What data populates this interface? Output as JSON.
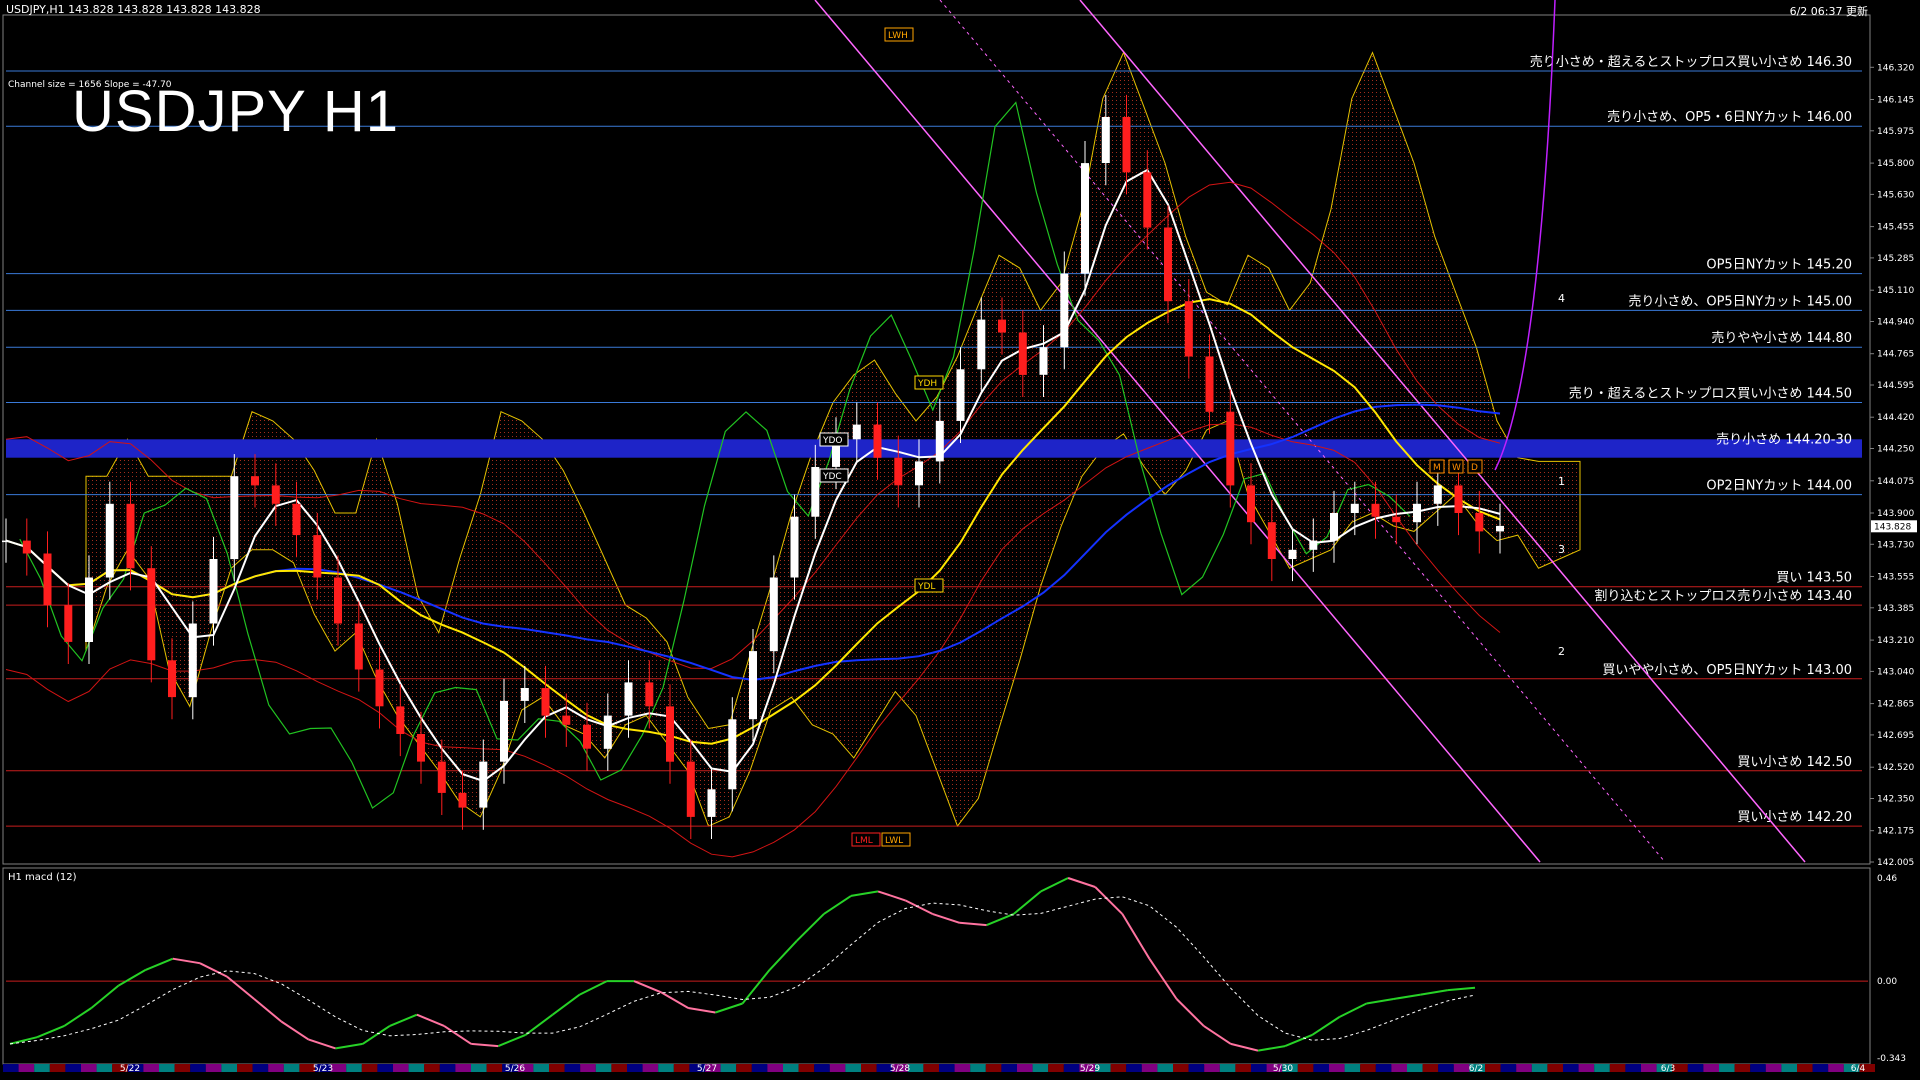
{
  "header": {
    "symbol_info": "USDJPY,H1  143.828 143.828 143.828 143.828",
    "updated": "6/2 06:37 更新",
    "channel_info": "Channel size = 1656 Slope = -47.70",
    "title": "USDJPY H1"
  },
  "colors": {
    "background": "#000000",
    "bull_candle": "#ffffff",
    "bear_candle": "#ff1e1e",
    "sma_white": "#ffffff",
    "sma_yellow": "#ffe600",
    "sma_blue": "#1432ff",
    "bollinger": "#d21414",
    "chikou": "#21c321",
    "channel": "#ff66ff",
    "cloud_bear": "#b4321e",
    "cloud_bull": "#b4b4b4",
    "resistance_line": "#3a7ad8",
    "support_line": "#c81e1e",
    "macd_up": "#27d227",
    "macd_down": "#ff73a0",
    "zone": "#1e24c8"
  },
  "chart_data": {
    "type": "line",
    "title": "USDJPY H1",
    "ylim": [
      142.005,
      146.49
    ],
    "price_ticks": [
      "146.320",
      "146.145",
      "145.975",
      "145.800",
      "145.630",
      "145.455",
      "145.285",
      "145.110",
      "144.940",
      "144.765",
      "144.595",
      "144.420",
      "144.250",
      "144.075",
      "143.900",
      "143.730",
      "143.555",
      "143.385",
      "143.210",
      "143.040",
      "142.865",
      "142.695",
      "142.520",
      "142.350",
      "142.175",
      "142.005"
    ],
    "last_price": "143.828",
    "date_labels": [
      "5/22",
      "5/23",
      "5/26",
      "5/27",
      "5/28",
      "5/29",
      "5/30",
      "6/2",
      "6/3",
      "6/4"
    ],
    "close_series": [
      143.75,
      143.68,
      143.4,
      143.2,
      143.55,
      143.95,
      143.6,
      143.1,
      142.9,
      143.3,
      143.65,
      144.1,
      144.05,
      143.95,
      143.78,
      143.55,
      143.3,
      143.05,
      142.85,
      142.7,
      142.55,
      142.38,
      142.3,
      142.55,
      142.88,
      142.95,
      142.8,
      142.75,
      142.62,
      142.8,
      142.98,
      142.85,
      142.55,
      142.25,
      142.4,
      142.78,
      143.15,
      143.55,
      143.88,
      144.15,
      144.3,
      144.38,
      144.2,
      144.05,
      144.18,
      144.4,
      144.68,
      144.95,
      144.88,
      144.65,
      144.8,
      145.2,
      145.8,
      146.05,
      145.75,
      145.45,
      145.05,
      144.75,
      144.45,
      144.05,
      143.85,
      143.65,
      143.7,
      143.75,
      143.9,
      143.95,
      143.88,
      143.85,
      143.95,
      144.05,
      143.9,
      143.8,
      143.83
    ],
    "price_levels": [
      {
        "price": 146.3,
        "label": "売り小さめ・超えるとストップロス買い小さめ 146.30",
        "kind": "resistance"
      },
      {
        "price": 146.0,
        "label": "売り小さめ、OP5・6日NYカット 146.00",
        "kind": "resistance"
      },
      {
        "price": 145.2,
        "label": "OP5日NYカット 145.20",
        "kind": "resistance"
      },
      {
        "price": 145.0,
        "label": "売り小さめ、OP5日NYカット 145.00",
        "kind": "resistance"
      },
      {
        "price": 144.8,
        "label": "売りやや小さめ 144.80",
        "kind": "resistance"
      },
      {
        "price": 144.5,
        "label": "売り・超えるとストップロス買い小さめ 144.50",
        "kind": "resistance"
      },
      {
        "price": 144.25,
        "label": "売り小さめ 144.20-30",
        "kind": "zone"
      },
      {
        "price": 144.0,
        "label": "OP2日NYカット 144.00",
        "kind": "resistance"
      },
      {
        "price": 143.5,
        "label": "買い 143.50",
        "kind": "support"
      },
      {
        "price": 143.4,
        "label": "割り込むとストップロス売り小さめ 143.40",
        "kind": "support"
      },
      {
        "price": 143.0,
        "label": "買いやや小さめ、OP5日NYカット 143.00",
        "kind": "support"
      },
      {
        "price": 142.5,
        "label": "買い小さめ 142.50",
        "kind": "support"
      },
      {
        "price": 142.2,
        "label": "買い小さめ 142.20",
        "kind": "support"
      }
    ],
    "marker_labels": [
      "LWH",
      "YDH",
      "YDO",
      "YDC",
      "YDL",
      "LML",
      "LWL",
      "M",
      "W",
      "D"
    ],
    "wave_labels": [
      "1",
      "2",
      "3",
      "4"
    ],
    "macd": {
      "name": "H1 macd (12)",
      "ticks": [
        "0.46",
        "0.00",
        "-0.343"
      ],
      "ylim": [
        -0.343,
        0.46
      ],
      "values": [
        -0.28,
        -0.25,
        -0.2,
        -0.12,
        -0.02,
        0.05,
        0.1,
        0.08,
        0.02,
        -0.08,
        -0.18,
        -0.26,
        -0.3,
        -0.28,
        -0.2,
        -0.15,
        -0.2,
        -0.28,
        -0.29,
        -0.24,
        -0.15,
        -0.06,
        0.0,
        0.0,
        -0.05,
        -0.12,
        -0.14,
        -0.1,
        0.05,
        0.18,
        0.3,
        0.38,
        0.4,
        0.36,
        0.3,
        0.26,
        0.25,
        0.3,
        0.4,
        0.46,
        0.42,
        0.3,
        0.1,
        -0.08,
        -0.2,
        -0.28,
        -0.31,
        -0.29,
        -0.24,
        -0.16,
        -0.1,
        -0.08,
        -0.06,
        -0.04,
        -0.03
      ]
    }
  }
}
